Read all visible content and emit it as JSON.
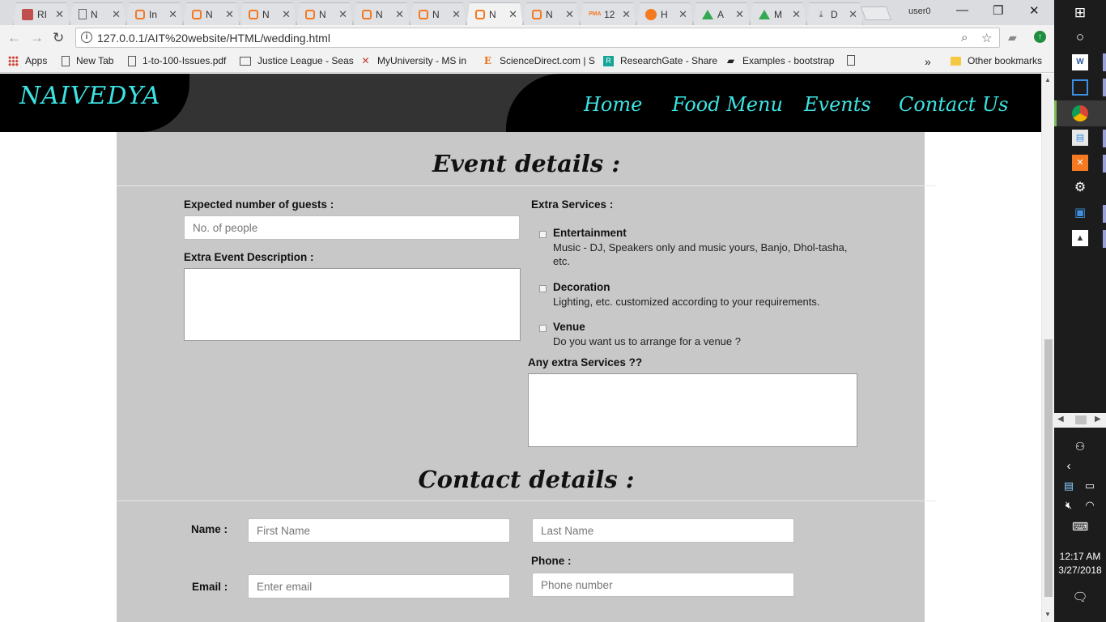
{
  "browser": {
    "tabs": [
      {
        "title": "RI",
        "icon": "person-icon"
      },
      {
        "title": "N",
        "icon": "document-icon"
      },
      {
        "title": "In",
        "icon": "xampp-icon"
      },
      {
        "title": "N",
        "icon": "xampp-icon"
      },
      {
        "title": "N",
        "icon": "xampp-icon"
      },
      {
        "title": "N",
        "icon": "xampp-icon"
      },
      {
        "title": "N",
        "icon": "xampp-icon"
      },
      {
        "title": "N",
        "icon": "xampp-icon"
      },
      {
        "title": "N",
        "icon": "xampp-icon",
        "active": true
      },
      {
        "title": "N",
        "icon": "xampp-icon"
      },
      {
        "title": "12",
        "icon": "pma-icon"
      },
      {
        "title": "H",
        "icon": "orange-circle-icon"
      },
      {
        "title": "A",
        "icon": "drive-icon"
      },
      {
        "title": "M",
        "icon": "drive-icon"
      },
      {
        "title": "D",
        "icon": "download-icon"
      }
    ],
    "user": "user0",
    "url": "127.0.0.1/AIT%20website/HTML/wedding.html",
    "bookmarks": [
      {
        "label": "Apps",
        "icon": "apps-grid-icon"
      },
      {
        "label": "New Tab",
        "icon": "document-icon"
      },
      {
        "label": "1-to-100-Issues.pdf",
        "icon": "document-icon"
      },
      {
        "label": "Justice League - Seas",
        "icon": "screen-icon"
      },
      {
        "label": "MyUniversity - MS in",
        "icon": "x-logo-icon"
      },
      {
        "label": "ScienceDirect.com | S",
        "icon": "elsevier-icon"
      },
      {
        "label": "ResearchGate - Share",
        "icon": "researchgate-icon"
      },
      {
        "label": "Examples - bootstrap",
        "icon": "book-icon"
      },
      {
        "label": "",
        "icon": "document-icon"
      }
    ],
    "more_bookmarks": "»",
    "other_bookmarks": "Other bookmarks"
  },
  "site": {
    "logo": "NAIVEDYA",
    "nav": [
      "Home",
      "Food Menu",
      "Events",
      "Contact Us"
    ]
  },
  "event_section": {
    "title": "Event details :",
    "guests_label": "Expected number of guests :",
    "guests_placeholder": "No. of people",
    "description_label": "Extra Event Description :",
    "extra_services_label": "Extra Services :",
    "services": [
      {
        "title": "Entertainment",
        "desc": "Music - DJ, Speakers only and music yours, Banjo, Dhol-tasha, etc."
      },
      {
        "title": "Decoration",
        "desc": "Lighting, etc. customized according to your requirements."
      },
      {
        "title": "Venue",
        "desc": "Do you want us to arrange for a venue ?"
      }
    ],
    "any_extra_label": "Any extra Services ??"
  },
  "contact_section": {
    "title": "Contact details :",
    "name_label": "Name :",
    "first_name_placeholder": "First Name",
    "last_name_placeholder": "Last Name",
    "phone_label": "Phone :",
    "email_label": "Email :",
    "email_placeholder": "Enter email",
    "phone_placeholder": "Phone number"
  },
  "taskbar": {
    "time": "12:17 AM",
    "date": "3/27/2018"
  }
}
